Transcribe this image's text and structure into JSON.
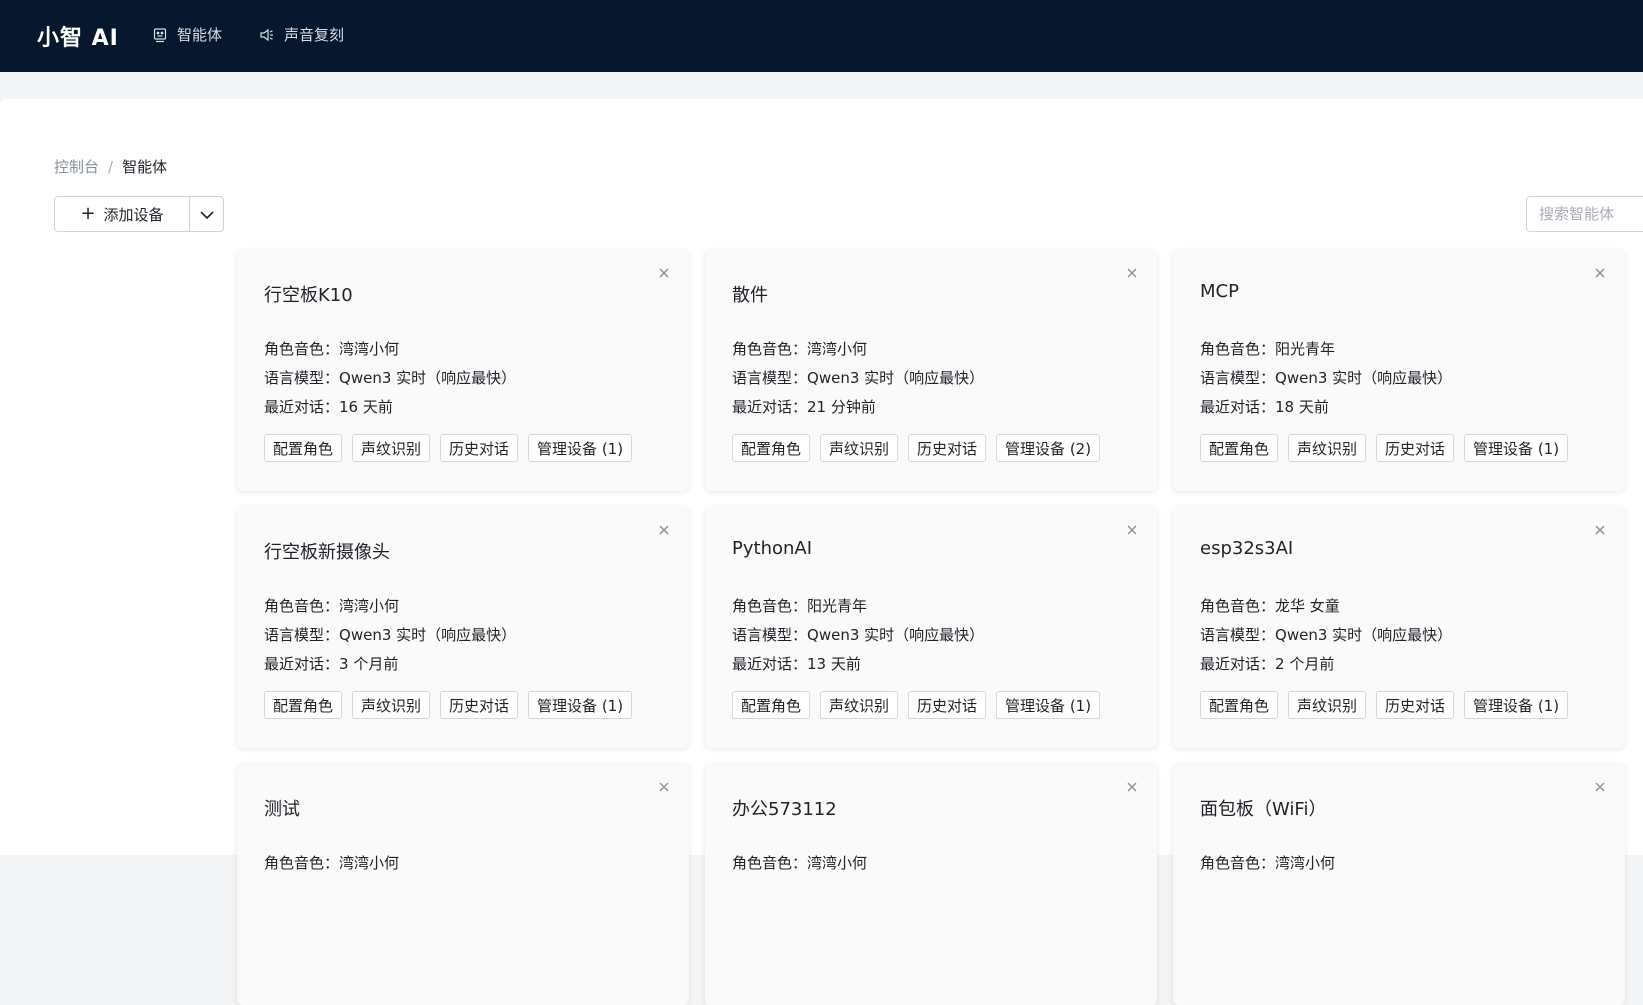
{
  "app": {
    "brand": "小智 AI",
    "nav": [
      {
        "label": "智能体",
        "icon": "robot-icon"
      },
      {
        "label": "声音复刻",
        "icon": "speaker-icon"
      }
    ]
  },
  "breadcrumb": {
    "root": "控制台",
    "separator": "/",
    "current": "智能体"
  },
  "toolbar": {
    "add_label": "添加设备",
    "search_placeholder": "搜索智能体"
  },
  "labels": {
    "voice": "角色音色：",
    "model": "语言模型：",
    "recent": "最近对话："
  },
  "actions": {
    "configure": "配置角色",
    "voiceprint": "声纹识别",
    "history": "历史对话"
  },
  "agents": [
    {
      "name": "行空板K10",
      "voice": "湾湾小何",
      "model": "Qwen3 实时（响应最快）",
      "recent": "16 天前",
      "manage": "管理设备 (1)"
    },
    {
      "name": "散件",
      "voice": "湾湾小何",
      "model": "Qwen3 实时（响应最快）",
      "recent": "21 分钟前",
      "manage": "管理设备 (2)"
    },
    {
      "name": "MCP",
      "voice": "阳光青年",
      "model": "Qwen3 实时（响应最快）",
      "recent": "18 天前",
      "manage": "管理设备 (1)"
    },
    {
      "name": "行空板新摄像头",
      "voice": "湾湾小何",
      "model": "Qwen3 实时（响应最快）",
      "recent": "3 个月前",
      "manage": "管理设备 (1)"
    },
    {
      "name": "PythonAI",
      "voice": "阳光青年",
      "model": "Qwen3 实时（响应最快）",
      "recent": "13 天前",
      "manage": "管理设备 (1)"
    },
    {
      "name": "esp32s3AI",
      "voice": "龙华 女童",
      "model": "Qwen3 实时（响应最快）",
      "recent": "2 个月前",
      "manage": "管理设备 (1)"
    },
    {
      "name": "测试",
      "voice": "湾湾小何"
    },
    {
      "name": "办公573112",
      "voice": "湾湾小何"
    },
    {
      "name": "面包板（WiFi）",
      "voice": "湾湾小何"
    }
  ]
}
